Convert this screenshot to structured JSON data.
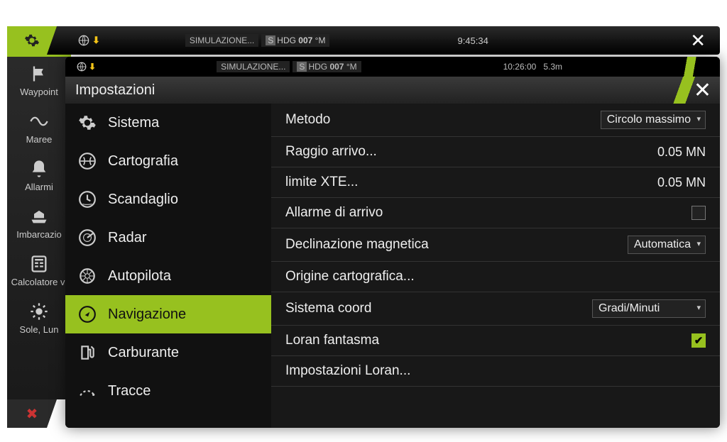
{
  "backbar": {
    "sim": "SIMULAZIONE...",
    "hdg_prefix": "S",
    "hdg_label": "HDG",
    "hdg_value": "007",
    "hdg_unit": "°M",
    "time": "9:45:34"
  },
  "outer": {
    "items": [
      {
        "label": "Waypoint"
      },
      {
        "label": "Maree"
      },
      {
        "label": "Allarmi"
      },
      {
        "label": "Imbarcazio"
      },
      {
        "label": "Calcolatore vi"
      },
      {
        "label": "Sole, Lun"
      }
    ]
  },
  "panel": {
    "topbar": {
      "sim": "SIMULAZIONE...",
      "hdg_prefix": "S",
      "hdg_label": "HDG",
      "hdg_value": "007",
      "hdg_unit": "°M",
      "time": "10:26:00",
      "depth": "5.3m"
    },
    "title": "Impostazioni",
    "categories": [
      {
        "label": "Sistema"
      },
      {
        "label": "Cartografia"
      },
      {
        "label": "Scandaglio"
      },
      {
        "label": "Radar"
      },
      {
        "label": "Autopilota"
      },
      {
        "label": "Navigazione",
        "active": true
      },
      {
        "label": "Carburante"
      },
      {
        "label": "Tracce"
      }
    ],
    "rows": {
      "metodo_label": "Metodo",
      "metodo_value": "Circolo massimo",
      "raggio_label": "Raggio arrivo...",
      "raggio_value": "0.05 MN",
      "xte_label": "limite XTE...",
      "xte_value": "0.05 MN",
      "allarme_label": "Allarme di arrivo",
      "declinazione_label": "Declinazione magnetica",
      "declinazione_value": "Automatica",
      "origine_label": "Origine cartografica...",
      "coord_label": "Sistema coord",
      "coord_value": "Gradi/Minuti",
      "loran_label": "Loran fantasma",
      "loranimp_label": "Impostazioni Loran..."
    }
  }
}
